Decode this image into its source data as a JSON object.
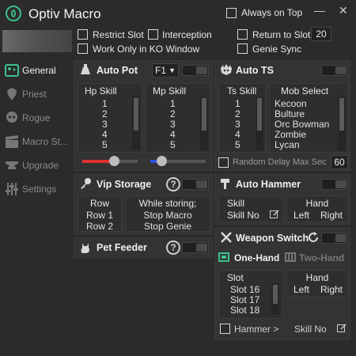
{
  "window": {
    "title": "Optiv Macro",
    "always_on_top_label": "Always on Top",
    "minimize": "—",
    "close": "✕"
  },
  "options": {
    "restrict_slot": "Restrict Slot",
    "interception": "Interception",
    "return_to_slot": "Return to Slot",
    "return_to_slot_value": "20",
    "work_only_in_ko": "Work Only in KO Window",
    "genie_sync": "Genie Sync"
  },
  "sidebar": {
    "items": [
      {
        "label": "General",
        "icon": "game-icon"
      },
      {
        "label": "Priest",
        "icon": "priest-icon"
      },
      {
        "label": "Rogue",
        "icon": "rogue-icon"
      },
      {
        "label": "Macro St...",
        "icon": "clapperboard-icon"
      },
      {
        "label": "Upgrade",
        "icon": "anvil-icon"
      },
      {
        "label": "Settings",
        "icon": "sliders-icon"
      }
    ]
  },
  "auto_pot": {
    "title": "Auto Pot",
    "key_value": "F1",
    "hp_label": "Hp Skill",
    "mp_label": "Mp Skill",
    "hp_items": [
      "1",
      "2",
      "3",
      "4",
      "5"
    ],
    "mp_items": [
      "1",
      "2",
      "3",
      "4",
      "5"
    ],
    "hp_color": "#e03030",
    "mp_color": "#3050e0"
  },
  "auto_ts": {
    "title": "Auto TS",
    "ts_label": "Ts Skill",
    "mob_label": "Mob Select",
    "ts_items": [
      "1",
      "2",
      "3",
      "4",
      "5"
    ],
    "mob_items": [
      "Kecoon",
      "Bulture",
      "Orc Bowman",
      "Zombie",
      "Lycan"
    ],
    "random_delay_label": "Random Delay Max Sec",
    "random_delay_value": "60"
  },
  "vip_storage": {
    "title": "Vip Storage",
    "row_label": "Row",
    "row_items": [
      "Row 1",
      "Row 2"
    ],
    "while_label": "While storing;",
    "while_items": [
      "Stop Macro",
      "Stop Genie"
    ]
  },
  "pet_feeder": {
    "title": "Pet Feeder"
  },
  "auto_hammer": {
    "title": "Auto Hammer",
    "skill_label": "Skill",
    "skill_value": "Skill No",
    "hand_label": "Hand",
    "left": "Left",
    "right": "Right"
  },
  "weapon_switch": {
    "title": "Weapon Switch",
    "one_hand": "One-Hand",
    "two_hand": "Two-Hand",
    "slot_label": "Slot",
    "slot_items": [
      "Slot 16",
      "Slot 17",
      "Slot 18"
    ],
    "hand_label": "Hand",
    "left": "Left",
    "right": "Right",
    "hammer_label": "Hammer >",
    "skill_no": "Skill No"
  },
  "colors": {
    "accent_green": "#3cc08a",
    "bg": "#2b2b2b",
    "panel": "#333333"
  }
}
